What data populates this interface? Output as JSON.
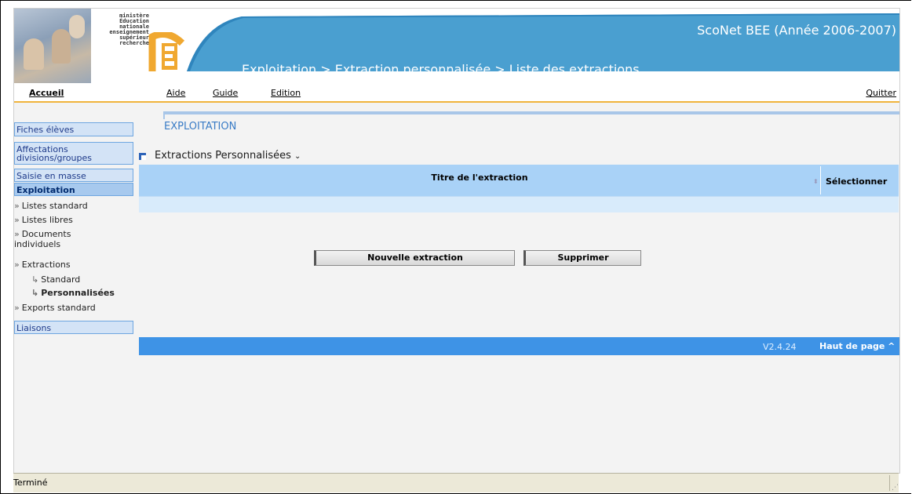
{
  "header": {
    "ministere_lines": "ministère\nÉducation\nnationale\nenseignement\nsupérieur\nrecherche",
    "app_title": "ScoNet BEE (Année 2006-2007)",
    "breadcrumb": "Exploitation > Extraction personnalisée > Liste des extractions"
  },
  "menu": {
    "accueil": "Accueil",
    "aide": "Aide",
    "guide": "Guide",
    "edition": "Edition",
    "quitter": "Quitter"
  },
  "sidebar": {
    "fiches": "Fiches élèves",
    "affectations": "Affectations divisions/groupes",
    "saisie": "Saisie en masse",
    "exploitation": "Exploitation",
    "listes_standard": "Listes standard",
    "listes_libres": "Listes libres",
    "documents": "Documents individuels",
    "extractions": "Extractions",
    "standard": "Standard",
    "personnalisees": "Personnalisées",
    "exports": "Exports standard",
    "liaisons": "Liaisons"
  },
  "main": {
    "page_title": "EXPLOITATION",
    "section_title": "Extractions Personnalisées",
    "col_title": "Titre de l'extraction",
    "col_select": "Sélectionner",
    "btn_new": "Nouvelle extraction",
    "btn_delete": "Supprimer",
    "version": "V2.4.24",
    "top_link": "Haut de page ^"
  },
  "status": {
    "text": "Terminé"
  },
  "colors": {
    "header_blue": "#4a9fd0",
    "accent_orange": "#f0b43c",
    "footer_blue": "#3e93e6",
    "table_head": "#a9d2f7"
  }
}
